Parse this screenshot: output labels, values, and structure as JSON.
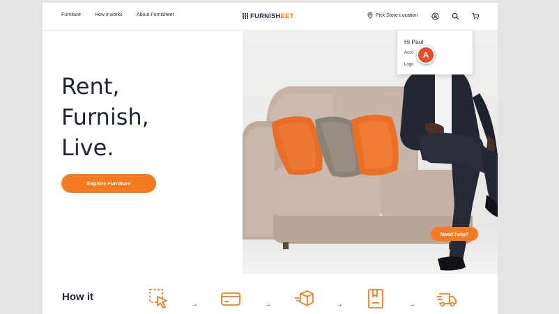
{
  "nav": {
    "links": [
      "Furniture",
      "How it works",
      "About Furnisheet"
    ],
    "logo": {
      "part1": "FURNISH",
      "part2": "EET"
    },
    "store_label": "Pick Store Location",
    "icons": [
      "account-icon",
      "search-icon",
      "cart-icon"
    ]
  },
  "hero": {
    "headline": [
      "Rent,",
      "Furnish,",
      "Live."
    ],
    "cta_label": "Explore Furniture"
  },
  "account_menu": {
    "greeting": "Hi Paul",
    "items": [
      "Acco",
      "Logo"
    ]
  },
  "annotation": {
    "label": "A"
  },
  "help": {
    "label": "Need help?"
  },
  "how_it_works": {
    "title": "How it",
    "steps": [
      "select-icon",
      "card-icon",
      "box-icon",
      "book-icon",
      "delivery-truck-icon"
    ],
    "arrow": "→"
  },
  "colors": {
    "accent": "#f47b20",
    "text": "#1d2536",
    "annotation": "#e8492a"
  }
}
